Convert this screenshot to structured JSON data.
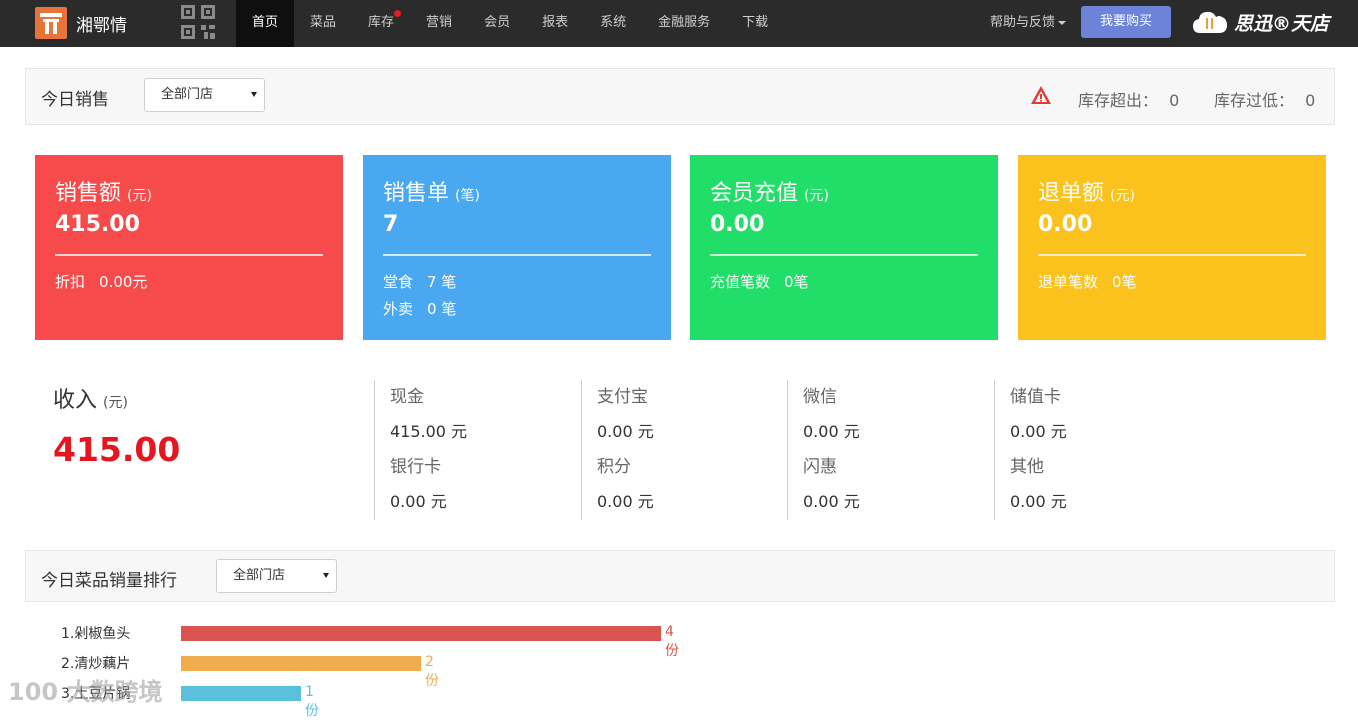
{
  "nav": {
    "brand_name": "湘鄂情",
    "items": [
      {
        "label": "首页",
        "active": true
      },
      {
        "label": "菜品"
      },
      {
        "label": "库存",
        "dot": true
      },
      {
        "label": "营销"
      },
      {
        "label": "会员"
      },
      {
        "label": "报表"
      },
      {
        "label": "系统"
      },
      {
        "label": "金融服务"
      },
      {
        "label": "下载"
      }
    ],
    "help_label": "帮助与反馈",
    "buy_label": "我要购买",
    "brand2_name": "思迅®天店",
    "icons": [
      "qr-code-icon",
      "cloud-logo-icon"
    ]
  },
  "today_sales": {
    "title": "今日销售",
    "store_select": "全部门店",
    "stock_over_label": "库存超出：",
    "stock_over_value": "0",
    "stock_low_label": "库存过低：",
    "stock_low_value": "0",
    "warning_icon": "warning-triangle-icon"
  },
  "cards": [
    {
      "title": "销售额",
      "unit": "(元)",
      "value": "415.00",
      "color": "#f74b4b",
      "subs": [
        {
          "label": "折扣",
          "value": "0.00元"
        }
      ]
    },
    {
      "title": "销售单",
      "unit": "(笔)",
      "value": "7",
      "color": "#4aa8f1",
      "subs": [
        {
          "label": "堂食",
          "value": "7 笔"
        },
        {
          "label": "外卖",
          "value": "0 笔"
        }
      ]
    },
    {
      "title": "会员充值",
      "unit": "(元)",
      "value": "0.00",
      "color": "#21de68",
      "subs": [
        {
          "label": "充值笔数",
          "value": "0笔"
        }
      ]
    },
    {
      "title": "退单额",
      "unit": "(元)",
      "value": "0.00",
      "color": "#fbc11d",
      "subs": [
        {
          "label": "退单笔数",
          "value": "0笔"
        }
      ]
    }
  ],
  "income": {
    "title": "收入",
    "unit": "(元)",
    "value": "415.00",
    "columns": [
      [
        {
          "label": "现金",
          "value": "415.00 元"
        },
        {
          "label": "银行卡",
          "value": "0.00 元"
        }
      ],
      [
        {
          "label": "支付宝",
          "value": "0.00 元"
        },
        {
          "label": "积分",
          "value": "0.00 元"
        }
      ],
      [
        {
          "label": "微信",
          "value": "0.00 元"
        },
        {
          "label": "闪惠",
          "value": "0.00 元"
        }
      ],
      [
        {
          "label": "储值卡",
          "value": "0.00 元"
        },
        {
          "label": "其他",
          "value": "0.00 元"
        }
      ]
    ]
  },
  "ranking": {
    "title": "今日菜品销量排行",
    "store_select": "全部门店",
    "max": 4,
    "items": [
      {
        "name": "1.剁椒鱼头",
        "count": "4份",
        "value": 4,
        "color": "#d9534f"
      },
      {
        "name": "2.清炒藕片",
        "count": "2份",
        "value": 2,
        "color": "#f0ad4e"
      },
      {
        "name": "3.土豆片锅",
        "count": "1份",
        "value": 1,
        "color": "#5bc0de"
      }
    ]
  },
  "watermark": "100 大数跨境"
}
